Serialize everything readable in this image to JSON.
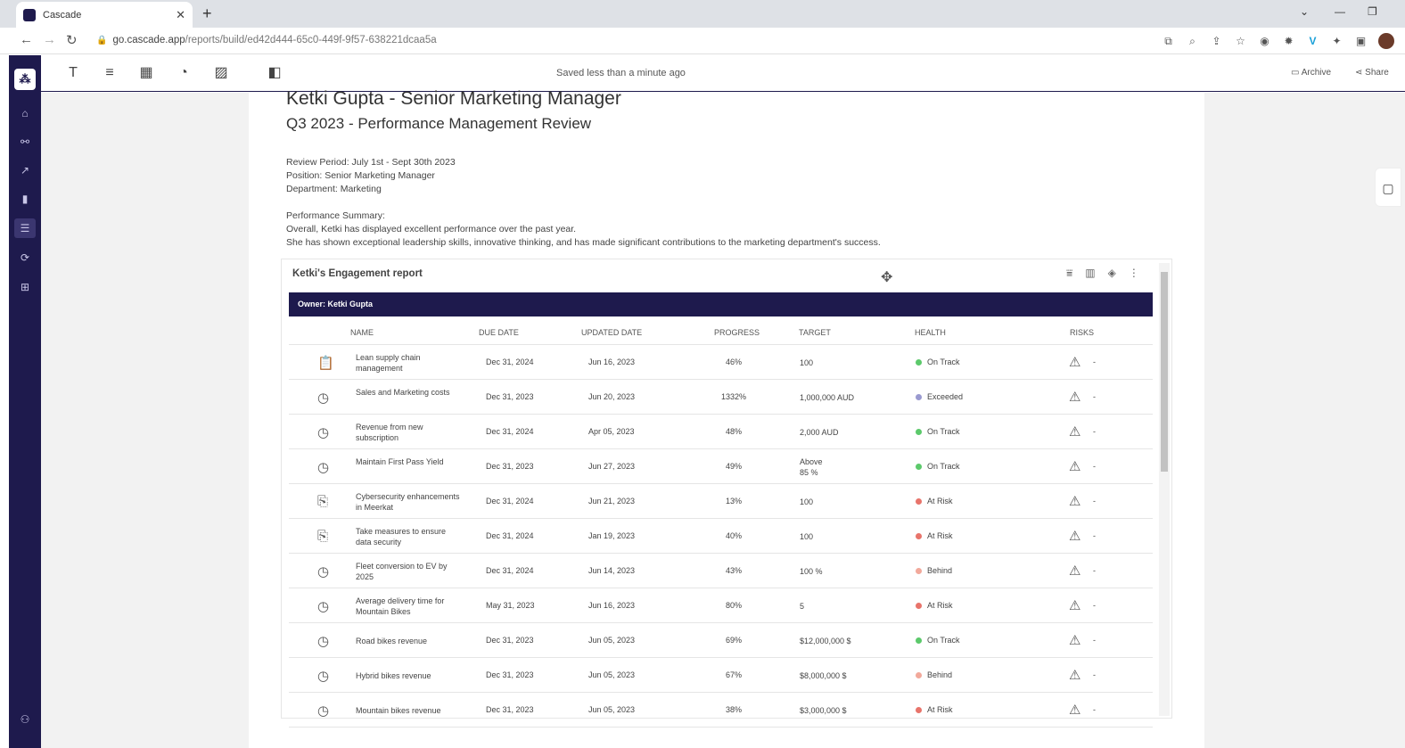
{
  "browser": {
    "tab_title": "Cascade",
    "url_host": "go.cascade.app",
    "url_path": "/reports/build/ed42d444-65c0-449f-9f57-638221dcaa5a"
  },
  "toolbar": {
    "saved_status": "Saved less than a minute ago",
    "archive_label": "Archive",
    "share_label": "Share"
  },
  "document": {
    "title": "Ketki Gupta - Senior Marketing Manager",
    "subtitle": "Q3 2023 - Performance Management Review",
    "review_period": "Review Period: July 1st - Sept 30th 2023",
    "position": "Position: Senior Marketing Manager",
    "department": "Department: Marketing",
    "summary_heading": "Performance Summary:",
    "summary_line1": "Overall, Ketki has displayed excellent performance over the past year.",
    "summary_line2": "She has shown exceptional leadership skills, innovative thinking, and has made significant contributions to the marketing department's success."
  },
  "widget": {
    "title": "Ketki's Engagement report",
    "owner": "Owner: Ketki Gupta",
    "columns": [
      "NAME",
      "DUE DATE",
      "UPDATED DATE",
      "PROGRESS",
      "TARGET",
      "HEALTH",
      "RISKS"
    ],
    "rows": [
      {
        "icon": "task-icon",
        "name": "Lean supply chain management",
        "due": "Dec 31, 2024",
        "updated": "Jun 16, 2023",
        "progress": "46%",
        "target": "100",
        "health": "On Track",
        "health_color": "#5cc96b",
        "risk": "-"
      },
      {
        "icon": "gauge-icon",
        "name": "Sales and Marketing costs",
        "due": "Dec 31, 2023",
        "updated": "Jun 20, 2023",
        "progress": "1332%",
        "target": "1,000,000 AUD",
        "health": "Exceeded",
        "health_color": "#9a9ad0",
        "risk": "-"
      },
      {
        "icon": "gauge-icon",
        "name": "Revenue from new subscription",
        "due": "Dec 31, 2024",
        "updated": "Apr 05, 2023",
        "progress": "48%",
        "target": "2,000 AUD",
        "health": "On Track",
        "health_color": "#5cc96b",
        "risk": "-"
      },
      {
        "icon": "gauge-icon",
        "name": "Maintain First Pass Yield",
        "due": "Dec 31, 2023",
        "updated": "Jun 27, 2023",
        "progress": "49%",
        "target": "Above 85 %",
        "health": "On Track",
        "health_color": "#5cc96b",
        "risk": "-"
      },
      {
        "icon": "project-icon",
        "name": "Cybersecurity enhancements in Meerkat",
        "due": "Dec 31, 2024",
        "updated": "Jun 21, 2023",
        "progress": "13%",
        "target": "100",
        "health": "At Risk",
        "health_color": "#e8746b",
        "risk": "-"
      },
      {
        "icon": "project-icon",
        "name": "Take measures to ensure data security",
        "due": "Dec 31, 2024",
        "updated": "Jan 19, 2023",
        "progress": "40%",
        "target": "100",
        "health": "At Risk",
        "health_color": "#e8746b",
        "risk": "-"
      },
      {
        "icon": "gauge-icon",
        "name": "Fleet conversion to EV by 2025",
        "due": "Dec 31, 2024",
        "updated": "Jun 14, 2023",
        "progress": "43%",
        "target": "100 %",
        "health": "Behind",
        "health_color": "#f2a99b",
        "risk": "-"
      },
      {
        "icon": "gauge-icon",
        "name": "Average delivery time for Mountain Bikes",
        "due": "May 31, 2023",
        "updated": "Jun 16, 2023",
        "progress": "80%",
        "target": "5",
        "health": "At Risk",
        "health_color": "#e8746b",
        "risk": "-"
      },
      {
        "icon": "gauge-icon",
        "name": "Road bikes revenue",
        "due": "Dec 31, 2023",
        "updated": "Jun 05, 2023",
        "progress": "69%",
        "target": "$12,000,000 $",
        "health": "On Track",
        "health_color": "#5cc96b",
        "risk": "-"
      },
      {
        "icon": "gauge-icon",
        "name": "Hybrid bikes revenue",
        "due": "Dec 31, 2023",
        "updated": "Jun 05, 2023",
        "progress": "67%",
        "target": "$8,000,000 $",
        "health": "Behind",
        "health_color": "#f2a99b",
        "risk": "-"
      },
      {
        "icon": "gauge-icon",
        "name": "Mountain bikes revenue",
        "due": "Dec 31, 2023",
        "updated": "Jun 05, 2023",
        "progress": "38%",
        "target": "$3,000,000 $",
        "health": "At Risk",
        "health_color": "#e8746b",
        "risk": "-"
      }
    ]
  }
}
